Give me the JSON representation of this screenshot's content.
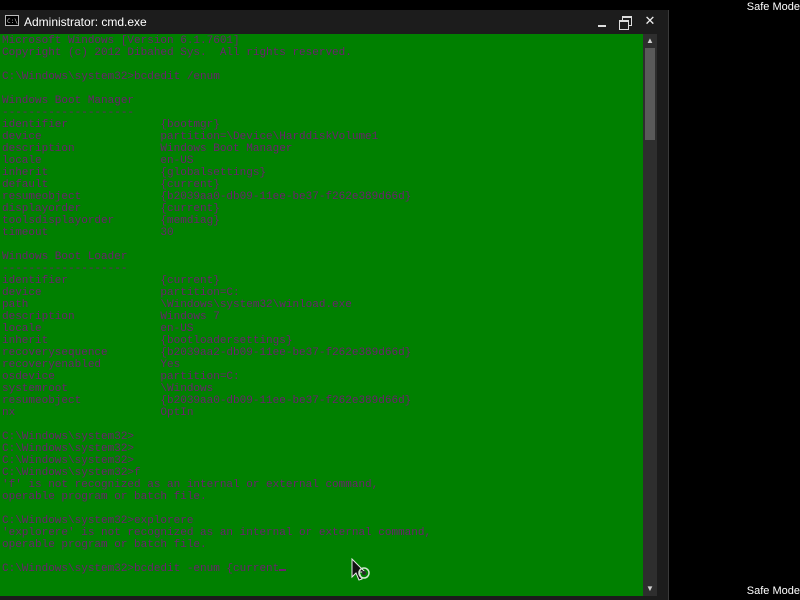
{
  "desktop": {
    "safe_mode_top": "Safe Mode",
    "safe_mode_bottom": "Safe Mode"
  },
  "window": {
    "title": "Administrator: cmd.exe",
    "icon": "cmd-icon",
    "controls": {
      "minimize": "minimize-icon",
      "maximize": "restore-icon",
      "close": "✕"
    }
  },
  "console": {
    "background": "#008000",
    "text_color": "#6d1f70",
    "lines": [
      "Microsoft Windows [Version 6.1.7601]",
      "Copyright (c) 2012 Dibahed Sys.  All rights reserved.",
      "",
      "C:\\Windows\\system32>bcdedit /enum",
      "",
      "Windows Boot Manager",
      "--------------------",
      "identifier              {bootmgr}",
      "device                  partition=\\Device\\HarddiskVolume1",
      "description             Windows Boot Manager",
      "locale                  en-US",
      "inherit                 {globalsettings}",
      "default                 {current}",
      "resumeobject            {b2039aa0-db09-11ee-be37-f262e389d66d}",
      "displayorder            {current}",
      "toolsdisplayorder       {memdiag}",
      "timeout                 30",
      "",
      "Windows Boot Loader",
      "-------------------",
      "identifier              {current}",
      "device                  partition=C:",
      "path                    \\Windows\\system32\\winload.exe",
      "description             Windows 7",
      "locale                  en-US",
      "inherit                 {bootloadersettings}",
      "recoverysequence        {b2039aa2-db09-11ee-be37-f262e389d66d}",
      "recoveryenabled         Yes",
      "osdevice                partition=C:",
      "systemroot              \\Windows",
      "resumeobject            {b2039aa0-db09-11ee-be37-f262e389d66d}",
      "nx                      OptIn",
      "",
      "C:\\Windows\\system32>",
      "C:\\Windows\\system32>",
      "C:\\Windows\\system32>",
      "C:\\Windows\\system32>f",
      "'f' is not recognized as an internal or external command,",
      "operable program or batch file.",
      "",
      "C:\\Windows\\system32>explorere",
      "'explorere' is not recognized as an internal or external command,",
      "operable program or batch file.",
      "",
      "C:\\Windows\\system32>bcdedit -enum {current"
    ]
  },
  "scrollbar": {
    "up": "▲",
    "down": "▼",
    "thumb_position_fraction": 0.0
  }
}
